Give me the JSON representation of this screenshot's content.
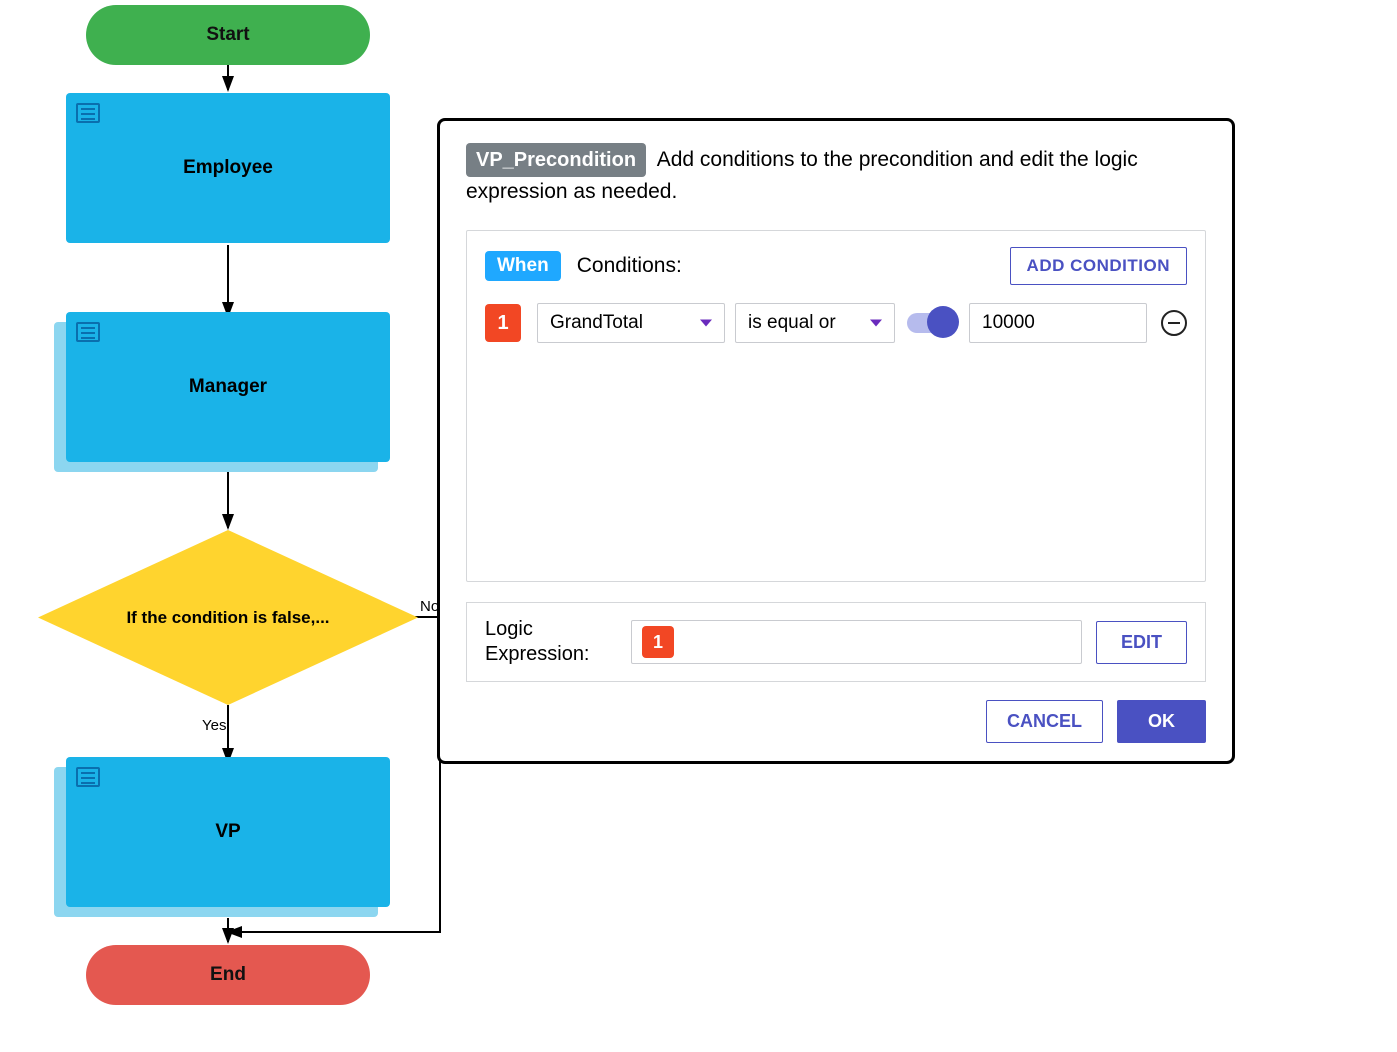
{
  "flowchart": {
    "start_label": "Start",
    "end_label": "End",
    "employee_label": "Employee",
    "manager_label": "Manager",
    "vp_label": "VP",
    "decision_text": "If the condition is false,...",
    "no_label": "No",
    "yes_label": "Yes"
  },
  "modal": {
    "title_badge": "VP_Precondition",
    "title_text": "Add conditions to the precondition and edit the logic expression as needed.",
    "when_badge": "When",
    "conditions_label": "Conditions:",
    "add_condition_btn": "ADD CONDITION",
    "condition": {
      "index": "1",
      "field": "GrandTotal",
      "operator": "is equal or",
      "value": "10000"
    },
    "logic_label": "Logic Expression:",
    "logic_value": "1",
    "edit_btn": "EDIT",
    "cancel_btn": "CANCEL",
    "ok_btn": "OK"
  }
}
